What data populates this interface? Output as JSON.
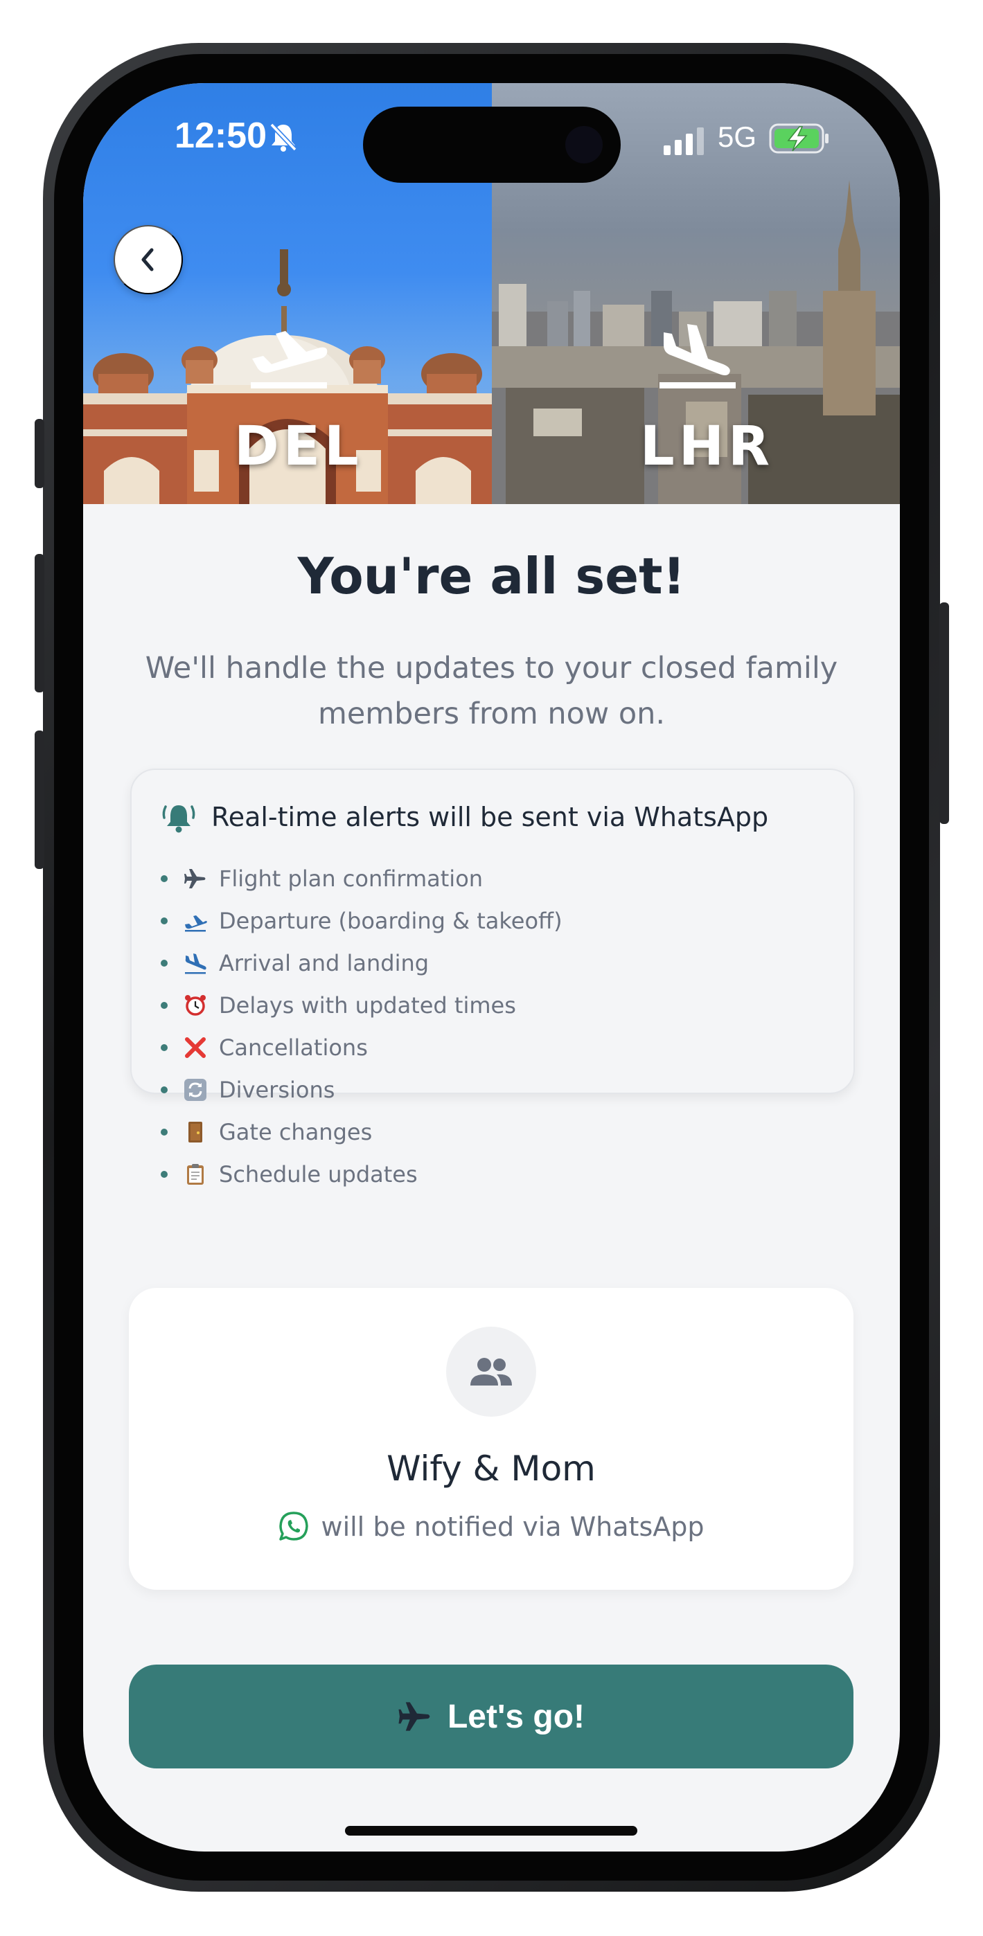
{
  "status_bar": {
    "time": "12:50",
    "network": "5G",
    "icons": [
      "bell-slash-icon",
      "signal-bars-icon",
      "battery-charging-icon"
    ]
  },
  "hero": {
    "origin": {
      "code": "DEL",
      "icon": "plane-departure-icon"
    },
    "destination": {
      "code": "LHR",
      "icon": "plane-arrival-icon"
    },
    "back_icon": "chevron-left-icon"
  },
  "confirmation": {
    "title": "You're all set!",
    "subtitle": "We'll handle the updates to your closed family members from now on."
  },
  "alerts": {
    "heading": "Real-time alerts will be sent via WhatsApp",
    "heading_icon": "bell-ringing-icon",
    "items": [
      {
        "icon": "airplane-icon",
        "label": "Flight plan confirmation"
      },
      {
        "icon": "departure-icon",
        "label": "Departure (boarding & takeoff)"
      },
      {
        "icon": "arrival-icon",
        "label": "Arrival and landing"
      },
      {
        "icon": "alarm-clock-icon",
        "label": "Delays with updated times"
      },
      {
        "icon": "cross-mark-icon",
        "label": "Cancellations"
      },
      {
        "icon": "arrows-cycle-icon",
        "label": "Diversions"
      },
      {
        "icon": "door-icon",
        "label": "Gate changes"
      },
      {
        "icon": "clipboard-icon",
        "label": "Schedule updates"
      }
    ]
  },
  "contact": {
    "name": "Wify & Mom",
    "note": "will be notified via WhatsApp",
    "avatar_icon": "people-group-icon",
    "note_icon": "whatsapp-icon"
  },
  "cta": {
    "label": "Let's go!",
    "icon": "airplane-icon"
  },
  "colors": {
    "accent": "#377b78",
    "title": "#1f2937",
    "muted": "#6b7280",
    "background": "#f4f5f7"
  }
}
